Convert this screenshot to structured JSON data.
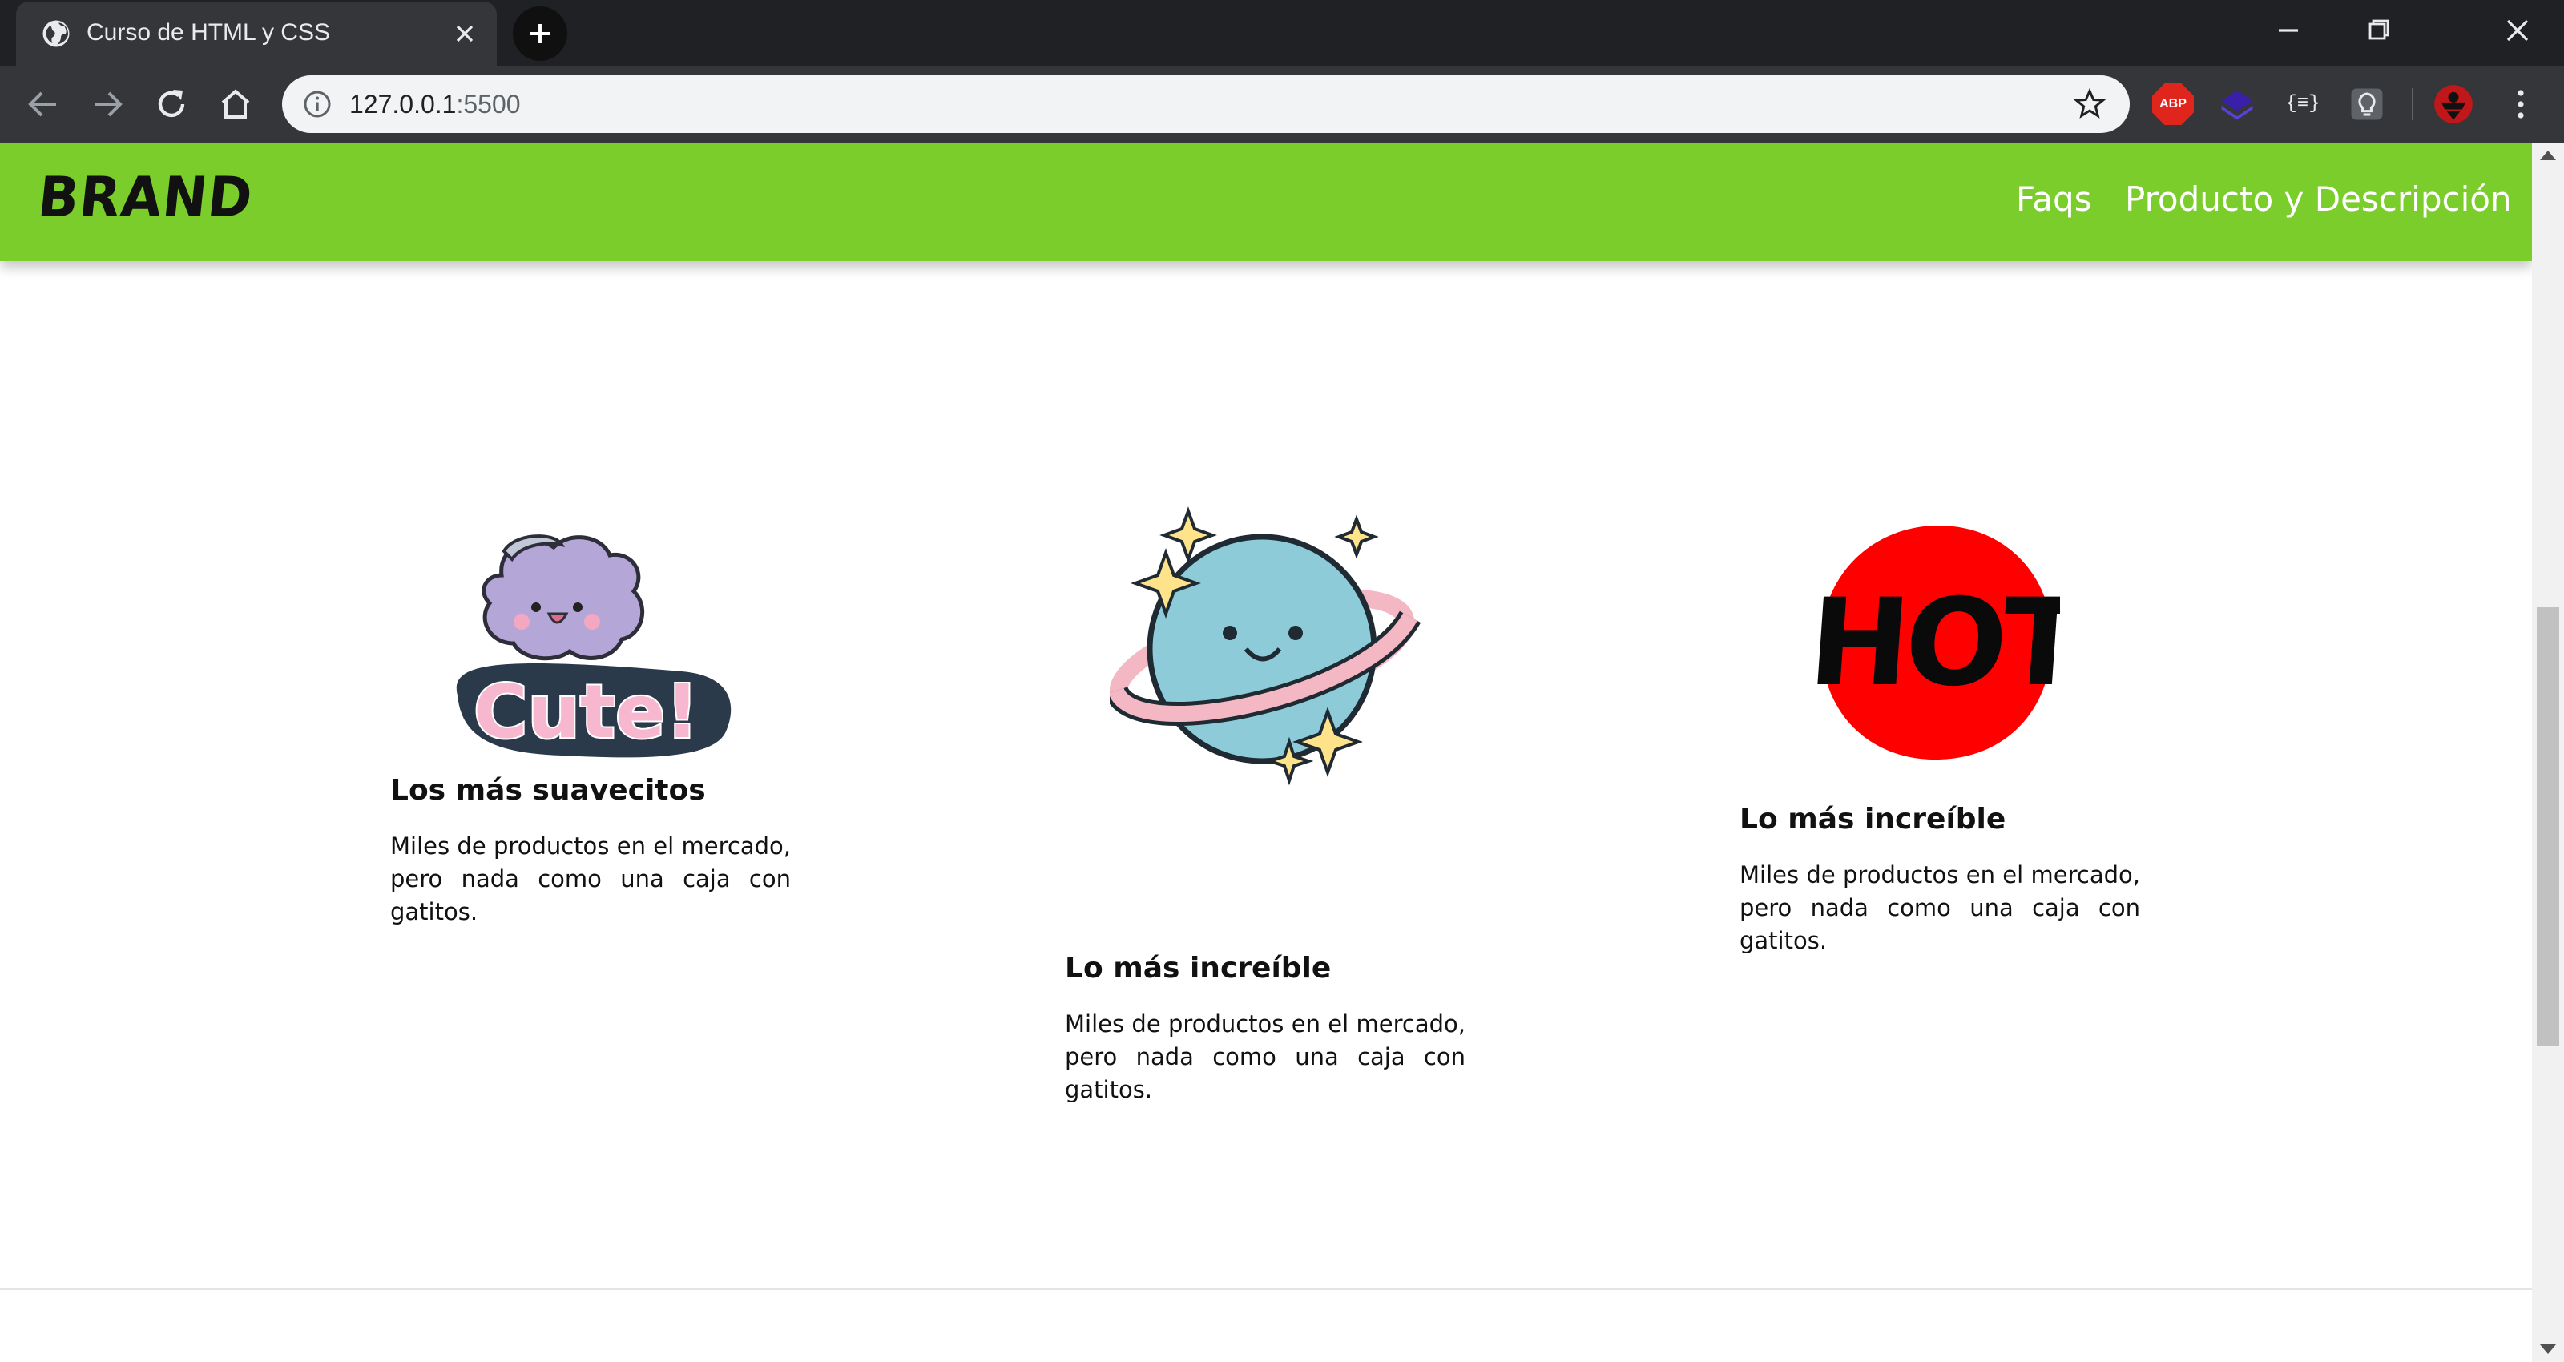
{
  "browser": {
    "tab_title": "Curso de HTML y CSS",
    "url_host": "127.0.0.1",
    "url_port": ":5500",
    "extensions": [
      {
        "name": "adblock-plus-icon",
        "label": "ABP"
      },
      {
        "name": "layers-extension-icon",
        "label": ""
      },
      {
        "name": "json-viewer-icon",
        "label": "{≡}"
      },
      {
        "name": "lightbulb-extension-icon",
        "label": ""
      }
    ]
  },
  "page": {
    "brand": "BRAND",
    "nav": [
      {
        "label": "Faqs"
      },
      {
        "label": "Producto y Descripción"
      }
    ],
    "cards": [
      {
        "image": "cute-sticker",
        "image_text": "Cute!",
        "title": "Los más suavecitos",
        "text": "Miles de productos en el mercado, pero nada como una caja con gatitos."
      },
      {
        "image": "planet-sticker",
        "title": "Lo más increíble",
        "text": "Miles de productos en el mercado, pero nada como una caja con gatitos."
      },
      {
        "image": "hot-sticker",
        "image_text": "HOT",
        "title": "Lo más increíble",
        "text": "Miles de productos en el mercado, pero nada como una caja con gatitos."
      }
    ]
  },
  "colors": {
    "navbar": "#7acd2b",
    "chrome_dark": "#202124",
    "chrome_toolbar": "#35363a",
    "hot_red": "#ff0000"
  }
}
